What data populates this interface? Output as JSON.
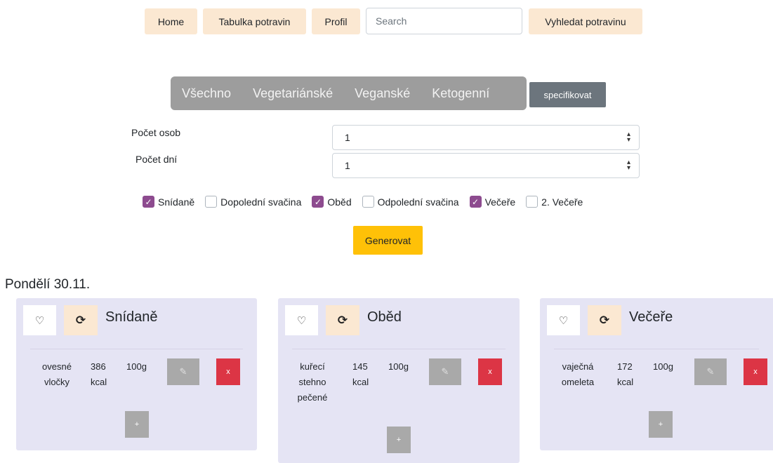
{
  "nav": {
    "home": "Home",
    "food_table": "Tabulka potravin",
    "profile": "Profil",
    "search_placeholder": "Search",
    "search_button": "Vyhledat potravinu"
  },
  "diet_filter": {
    "tabs": [
      "Všechno",
      "Vegetariánské",
      "Veganské",
      "Ketogenní"
    ],
    "specify_button": "specifikovat"
  },
  "form": {
    "persons_label": "Počet osob",
    "persons_value": "1",
    "days_label": "Počet dní",
    "days_value": "1"
  },
  "meals": [
    {
      "label": "Snídaně",
      "checked": true
    },
    {
      "label": "Dopolední svačina",
      "checked": false
    },
    {
      "label": "Oběd",
      "checked": true
    },
    {
      "label": "Odpolední svačina",
      "checked": false
    },
    {
      "label": "Večeře",
      "checked": true
    },
    {
      "label": "2. Večeře",
      "checked": false
    }
  ],
  "generate_button": "Generovat",
  "day": {
    "heading": "Pondělí 30.11.",
    "cards": [
      {
        "title": "Snídaně",
        "item": {
          "name_lines": [
            "ovesné",
            "vločky"
          ],
          "kcal_lines": [
            "386",
            "kcal"
          ],
          "grams": "100g"
        },
        "edit_icon": "edit-icon",
        "delete_label": "x",
        "add_label": "+"
      },
      {
        "title": "Oběd",
        "item": {
          "name_lines": [
            "kuřecí",
            "stehno",
            "pečené"
          ],
          "kcal_lines": [
            "145",
            "kcal"
          ],
          "grams": "100g"
        },
        "edit_icon": "edit-icon",
        "delete_label": "x",
        "add_label": "+"
      },
      {
        "title": "Večeře",
        "item": {
          "name_lines": [
            "vaječná",
            "omeleta"
          ],
          "kcal_lines": [
            "172",
            "kcal"
          ],
          "grams": "100g"
        },
        "edit_icon": "edit-icon",
        "delete_label": "x",
        "add_label": "+"
      }
    ]
  },
  "icons": {
    "favorite": "heart-outline-icon",
    "swap": "refresh-icon",
    "select_arrow": "sort-arrows-icon"
  },
  "colors": {
    "nav_button_bg": "#fbe8d2",
    "diet_group_bg": "#9d9d9d",
    "specify_bg": "#6c757d",
    "checkbox_checked": "#8d4b8f",
    "generate_bg": "#ffc107",
    "card_bg": "#e5e4f4",
    "delete_bg": "#dc3545",
    "grey_button": "#a9a9a9"
  }
}
